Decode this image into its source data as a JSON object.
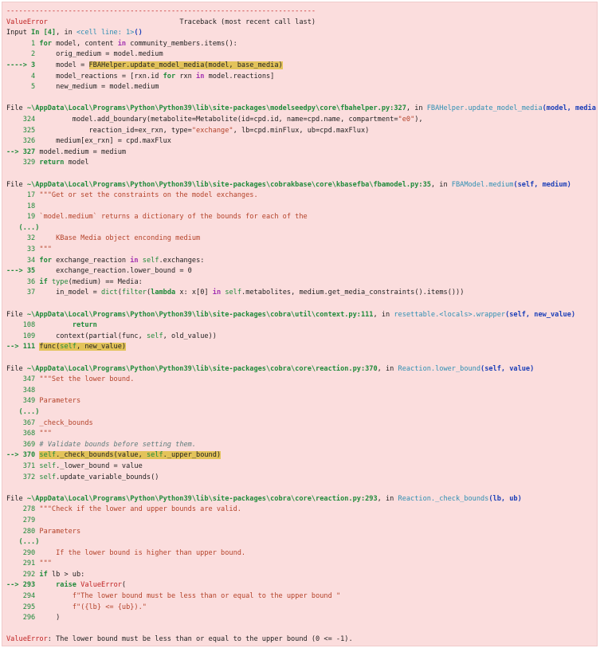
{
  "traceback": {
    "lines": [
      [
        {
          "t": "---------------------------------------------------------------------------",
          "c": "t-dash"
        }
      ],
      [
        {
          "t": "ValueError",
          "c": "t-red"
        },
        {
          "t": "                                Traceback (most recent call last)",
          "c": ""
        }
      ],
      [
        {
          "t": "Input ",
          "c": ""
        },
        {
          "t": "In [4]",
          "c": "t-greenb"
        },
        {
          "t": ", in ",
          "c": ""
        },
        {
          "t": "<cell line: 1>",
          "c": "t-cyan"
        },
        {
          "t": "()",
          "c": "t-bluebold"
        }
      ],
      [
        {
          "t": "      1 ",
          "c": "t-green"
        },
        {
          "t": "for",
          "c": "t-kw"
        },
        {
          "t": " model, content ",
          "c": ""
        },
        {
          "t": "in",
          "c": "t-mag"
        },
        {
          "t": " community_members.items():",
          "c": ""
        }
      ],
      [
        {
          "t": "      2 ",
          "c": "t-green"
        },
        {
          "t": "    orig_medium = model.medium",
          "c": ""
        }
      ],
      [
        {
          "t": "----> 3 ",
          "c": "t-greenb"
        },
        {
          "t": "    model = ",
          "c": ""
        },
        {
          "t": "FBAHelper.update_model_media(model, base_media)",
          "c": "t-hl"
        }
      ],
      [
        {
          "t": "      4 ",
          "c": "t-green"
        },
        {
          "t": "    model_reactions = [rxn.id ",
          "c": ""
        },
        {
          "t": "for",
          "c": "t-kw"
        },
        {
          "t": " rxn ",
          "c": ""
        },
        {
          "t": "in",
          "c": "t-mag"
        },
        {
          "t": " model.reactions]",
          "c": ""
        }
      ],
      [
        {
          "t": "      5 ",
          "c": "t-green"
        },
        {
          "t": "    new_medium = model.medium",
          "c": ""
        }
      ],
      [],
      [
        {
          "t": "File ",
          "c": ""
        },
        {
          "t": "~\\AppData\\Local\\Programs\\Python\\Python39\\lib\\site-packages\\modelseedpy\\core\\fbahelper.py:327",
          "c": "t-greenb"
        },
        {
          "t": ", in ",
          "c": ""
        },
        {
          "t": "FBAHelper.update_model_media",
          "c": "t-cyan"
        },
        {
          "t": "(model, media)",
          "c": "t-bluebold"
        }
      ],
      [
        {
          "t": "    324 ",
          "c": "t-green"
        },
        {
          "t": "        model.add_boundary(metabolite=Metabolite(id=cpd.id, name=cpd.name, compartment=",
          "c": ""
        },
        {
          "t": "\"e0\"",
          "c": "t-str"
        },
        {
          "t": "),",
          "c": ""
        }
      ],
      [
        {
          "t": "    325 ",
          "c": "t-green"
        },
        {
          "t": "            reaction_id=ex_rxn, type=",
          "c": ""
        },
        {
          "t": "\"exchange\"",
          "c": "t-str"
        },
        {
          "t": ", lb=cpd.minFlux, ub=cpd.maxFlux)",
          "c": ""
        }
      ],
      [
        {
          "t": "    326 ",
          "c": "t-green"
        },
        {
          "t": "    medium[ex_rxn] = cpd.maxFlux",
          "c": ""
        }
      ],
      [
        {
          "t": "--> 327 ",
          "c": "t-greenb"
        },
        {
          "t": "model.medium = medium",
          "c": ""
        }
      ],
      [
        {
          "t": "    329 ",
          "c": "t-green"
        },
        {
          "t": "return",
          "c": "t-kw"
        },
        {
          "t": " model",
          "c": ""
        }
      ],
      [],
      [
        {
          "t": "File ",
          "c": ""
        },
        {
          "t": "~\\AppData\\Local\\Programs\\Python\\Python39\\lib\\site-packages\\cobrakbase\\core\\kbasefba\\fbamodel.py:35",
          "c": "t-greenb"
        },
        {
          "t": ", in ",
          "c": ""
        },
        {
          "t": "FBAModel.medium",
          "c": "t-cyan"
        },
        {
          "t": "(self, medium)",
          "c": "t-bluebold"
        }
      ],
      [
        {
          "t": "     17 ",
          "c": "t-green"
        },
        {
          "t": "\"\"\"Get or set the constraints on the model exchanges.",
          "c": "t-str"
        }
      ],
      [
        {
          "t": "     18 ",
          "c": "t-green"
        }
      ],
      [
        {
          "t": "     19 ",
          "c": "t-green"
        },
        {
          "t": "`model.medium` returns a dictionary of the bounds for each of the",
          "c": "t-str"
        }
      ],
      [
        {
          "t": "   (...)",
          "c": "t-greenb"
        }
      ],
      [
        {
          "t": "     32 ",
          "c": "t-green"
        },
        {
          "t": "    KBase Media object enconding medium",
          "c": "t-str"
        }
      ],
      [
        {
          "t": "     33 ",
          "c": "t-green"
        },
        {
          "t": "\"\"\"",
          "c": "t-str"
        }
      ],
      [
        {
          "t": "     34 ",
          "c": "t-green"
        },
        {
          "t": "for",
          "c": "t-kw"
        },
        {
          "t": " exchange_reaction ",
          "c": ""
        },
        {
          "t": "in",
          "c": "t-mag"
        },
        {
          "t": " ",
          "c": ""
        },
        {
          "t": "self",
          "c": "t-green"
        },
        {
          "t": ".exchanges:",
          "c": ""
        }
      ],
      [
        {
          "t": "---> 35 ",
          "c": "t-greenb"
        },
        {
          "t": "    exchange_reaction.lower_bound = 0",
          "c": ""
        }
      ],
      [
        {
          "t": "     36 ",
          "c": "t-green"
        },
        {
          "t": "if",
          "c": "t-kw"
        },
        {
          "t": " ",
          "c": ""
        },
        {
          "t": "type",
          "c": "t-green"
        },
        {
          "t": "(medium) == Media:",
          "c": ""
        }
      ],
      [
        {
          "t": "     37 ",
          "c": "t-green"
        },
        {
          "t": "    in_model = ",
          "c": ""
        },
        {
          "t": "dict",
          "c": "t-green"
        },
        {
          "t": "(",
          "c": ""
        },
        {
          "t": "filter",
          "c": "t-green"
        },
        {
          "t": "(",
          "c": ""
        },
        {
          "t": "lambda",
          "c": "t-kw"
        },
        {
          "t": " x: x[0] ",
          "c": ""
        },
        {
          "t": "in",
          "c": "t-mag"
        },
        {
          "t": " ",
          "c": ""
        },
        {
          "t": "self",
          "c": "t-green"
        },
        {
          "t": ".metabolites, medium.get_media_constraints().items()))",
          "c": ""
        }
      ],
      [],
      [
        {
          "t": "File ",
          "c": ""
        },
        {
          "t": "~\\AppData\\Local\\Programs\\Python\\Python39\\lib\\site-packages\\cobra\\util\\context.py:111",
          "c": "t-greenb"
        },
        {
          "t": ", in ",
          "c": ""
        },
        {
          "t": "resettable.<locals>.wrapper",
          "c": "t-cyan"
        },
        {
          "t": "(self, new_value)",
          "c": "t-bluebold"
        }
      ],
      [
        {
          "t": "    108 ",
          "c": "t-green"
        },
        {
          "t": "        ",
          "c": ""
        },
        {
          "t": "return",
          "c": "t-kw"
        }
      ],
      [
        {
          "t": "    109 ",
          "c": "t-green"
        },
        {
          "t": "    context(partial(func, ",
          "c": ""
        },
        {
          "t": "self",
          "c": "t-green"
        },
        {
          "t": ", old_value))",
          "c": ""
        }
      ],
      [
        {
          "t": "--> 111 ",
          "c": "t-greenb"
        },
        {
          "t": "func(",
          "c": "t-hl"
        },
        {
          "t": "self",
          "c": "t-hl t-green"
        },
        {
          "t": ", new_value)",
          "c": "t-hl"
        }
      ],
      [],
      [
        {
          "t": "File ",
          "c": ""
        },
        {
          "t": "~\\AppData\\Local\\Programs\\Python\\Python39\\lib\\site-packages\\cobra\\core\\reaction.py:370",
          "c": "t-greenb"
        },
        {
          "t": ", in ",
          "c": ""
        },
        {
          "t": "Reaction.lower_bound",
          "c": "t-cyan"
        },
        {
          "t": "(self, value)",
          "c": "t-bluebold"
        }
      ],
      [
        {
          "t": "    347 ",
          "c": "t-green"
        },
        {
          "t": "\"\"\"Set the lower bound.",
          "c": "t-str"
        }
      ],
      [
        {
          "t": "    348 ",
          "c": "t-green"
        }
      ],
      [
        {
          "t": "    349 ",
          "c": "t-green"
        },
        {
          "t": "Parameters",
          "c": "t-str"
        }
      ],
      [
        {
          "t": "   (...)",
          "c": "t-greenb"
        }
      ],
      [
        {
          "t": "    367 ",
          "c": "t-green"
        },
        {
          "t": "_check_bounds",
          "c": "t-str"
        }
      ],
      [
        {
          "t": "    368 ",
          "c": "t-green"
        },
        {
          "t": "\"\"\"",
          "c": "t-str"
        }
      ],
      [
        {
          "t": "    369 ",
          "c": "t-green"
        },
        {
          "t": "# Validate bounds before setting them.",
          "c": "t-cmt"
        }
      ],
      [
        {
          "t": "--> 370 ",
          "c": "t-greenb"
        },
        {
          "t": "self",
          "c": "t-hl t-green"
        },
        {
          "t": "._check_bounds(value, ",
          "c": "t-hl"
        },
        {
          "t": "self",
          "c": "t-hl t-green"
        },
        {
          "t": "._upper_bound)",
          "c": "t-hl"
        }
      ],
      [
        {
          "t": "    371 ",
          "c": "t-green"
        },
        {
          "t": "self",
          "c": "t-green"
        },
        {
          "t": "._lower_bound = value",
          "c": ""
        }
      ],
      [
        {
          "t": "    372 ",
          "c": "t-green"
        },
        {
          "t": "self",
          "c": "t-green"
        },
        {
          "t": ".update_variable_bounds()",
          "c": ""
        }
      ],
      [],
      [
        {
          "t": "File ",
          "c": ""
        },
        {
          "t": "~\\AppData\\Local\\Programs\\Python\\Python39\\lib\\site-packages\\cobra\\core\\reaction.py:293",
          "c": "t-greenb"
        },
        {
          "t": ", in ",
          "c": ""
        },
        {
          "t": "Reaction._check_bounds",
          "c": "t-cyan"
        },
        {
          "t": "(lb, ub)",
          "c": "t-bluebold"
        }
      ],
      [
        {
          "t": "    278 ",
          "c": "t-green"
        },
        {
          "t": "\"\"\"Check if the lower and upper bounds are valid.",
          "c": "t-str"
        }
      ],
      [
        {
          "t": "    279 ",
          "c": "t-green"
        }
      ],
      [
        {
          "t": "    280 ",
          "c": "t-green"
        },
        {
          "t": "Parameters",
          "c": "t-str"
        }
      ],
      [
        {
          "t": "   (...)",
          "c": "t-greenb"
        }
      ],
      [
        {
          "t": "    290 ",
          "c": "t-green"
        },
        {
          "t": "    If the lower bound is higher than upper bound.",
          "c": "t-str"
        }
      ],
      [
        {
          "t": "    291 ",
          "c": "t-green"
        },
        {
          "t": "\"\"\"",
          "c": "t-str"
        }
      ],
      [
        {
          "t": "    292 ",
          "c": "t-green"
        },
        {
          "t": "if",
          "c": "t-kw"
        },
        {
          "t": " lb > ub:",
          "c": ""
        }
      ],
      [
        {
          "t": "--> 293 ",
          "c": "t-greenb"
        },
        {
          "t": "    ",
          "c": ""
        },
        {
          "t": "raise",
          "c": "t-kw"
        },
        {
          "t": " ",
          "c": ""
        },
        {
          "t": "ValueError",
          "c": "t-red"
        },
        {
          "t": "(",
          "c": ""
        }
      ],
      [
        {
          "t": "    294 ",
          "c": "t-green"
        },
        {
          "t": "        ",
          "c": ""
        },
        {
          "t": "f\"The lower bound must be less than or equal to the upper bound \"",
          "c": "t-str"
        }
      ],
      [
        {
          "t": "    295 ",
          "c": "t-green"
        },
        {
          "t": "        ",
          "c": ""
        },
        {
          "t": "f\"({lb} <= {ub}).\"",
          "c": "t-str"
        }
      ],
      [
        {
          "t": "    296 ",
          "c": "t-green"
        },
        {
          "t": "    )",
          "c": ""
        }
      ],
      [],
      [
        {
          "t": "ValueError",
          "c": "t-red"
        },
        {
          "t": ": The lower bound must be less than or equal to the upper bound (0 <= -1).",
          "c": ""
        }
      ]
    ]
  }
}
